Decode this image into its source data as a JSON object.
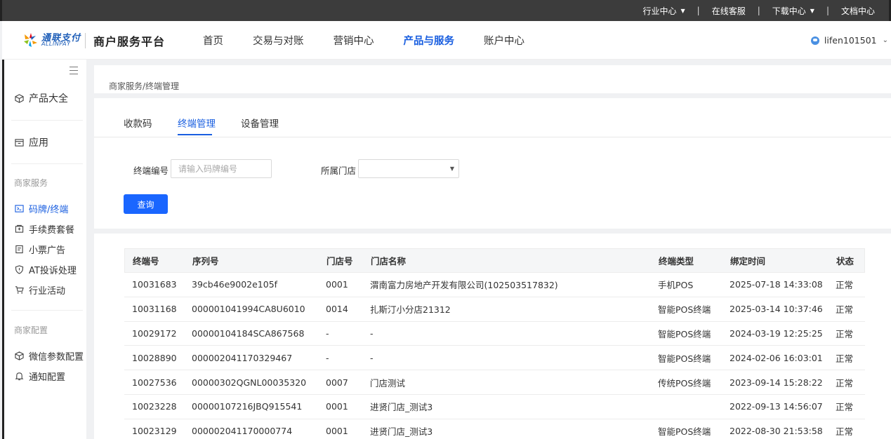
{
  "topbar": {
    "links": [
      {
        "label": "行业中心",
        "has_caret": true
      },
      {
        "label": "在线客服",
        "has_caret": false
      },
      {
        "label": "下载中心",
        "has_caret": true
      },
      {
        "label": "文档中心",
        "has_caret": false
      }
    ],
    "separator": "|"
  },
  "header": {
    "logo_name": "通联支付",
    "logo_sub": "ALLINPAY",
    "platform": "商户服务平台",
    "nav": [
      {
        "label": "首页",
        "active": false
      },
      {
        "label": "交易与对账",
        "active": false
      },
      {
        "label": "营销中心",
        "active": false
      },
      {
        "label": "产品与服务",
        "active": true
      },
      {
        "label": "账户中心",
        "active": false
      }
    ],
    "username": "lifen101501"
  },
  "sidebar": {
    "top_items": [
      {
        "label": "产品大全",
        "icon": "cube-icon"
      },
      {
        "label": "应用",
        "icon": "app-box-icon"
      }
    ],
    "group1_title": "商家服务",
    "group1_items": [
      {
        "label": "码牌/终端",
        "icon": "terminal-icon",
        "active": true
      },
      {
        "label": "手续费套餐",
        "icon": "fee-package-icon",
        "active": false
      },
      {
        "label": "小票广告",
        "icon": "receipt-icon",
        "active": false
      },
      {
        "label": "AT投诉处理",
        "icon": "shield-icon",
        "active": false
      },
      {
        "label": "行业活动",
        "icon": "cart-icon",
        "active": false
      }
    ],
    "group2_title": "商家配置",
    "group2_items": [
      {
        "label": "微信参数配置",
        "icon": "cube-icon"
      },
      {
        "label": "通知配置",
        "icon": "bell-icon"
      }
    ]
  },
  "breadcrumb": "商家服务/终端管理",
  "tabs": [
    {
      "label": "收款码",
      "active": false
    },
    {
      "label": "终端管理",
      "active": true
    },
    {
      "label": "设备管理",
      "active": false
    }
  ],
  "filter": {
    "terminal_label": "终端编号",
    "terminal_placeholder": "请输入码牌编号",
    "terminal_value": "",
    "store_label": "所属门店",
    "store_value": "",
    "query_button": "查询"
  },
  "table": {
    "columns": [
      "终端号",
      "序列号",
      "门店号",
      "门店名称",
      "终端类型",
      "绑定时间",
      "状态"
    ],
    "rows": [
      [
        "10031683",
        "39cb46e9002e105f",
        "0001",
        "渭南富力房地产开发有限公司(102503517832)",
        "手机POS",
        "2025-07-18 14:33:08",
        "正常"
      ],
      [
        "10031168",
        "000001041994CA8U6010",
        "0014",
        "扎斯汀小分店21312",
        "智能POS终端",
        "2025-03-14 10:37:46",
        "正常"
      ],
      [
        "10029172",
        "00000104184SCA867568",
        "-",
        "-",
        "智能POS终端",
        "2024-03-19 12:25:25",
        "正常"
      ],
      [
        "10028890",
        "000002041170329467",
        "-",
        "-",
        "智能POS终端",
        "2024-02-06 16:03:01",
        "正常"
      ],
      [
        "10027536",
        "00000302QGNL00035320",
        "0007",
        "门店测试",
        "传统POS终端",
        "2023-09-14 15:28:22",
        "正常"
      ],
      [
        "10023228",
        "00000107216JBQ915541",
        "0001",
        "进贤门店_测试3",
        "",
        "2022-09-13 14:56:07",
        "正常"
      ],
      [
        "10023129",
        "000002041170000774",
        "0001",
        "进贤门店_测试3",
        "智能POS终端",
        "2022-08-30 21:53:58",
        "正常"
      ]
    ]
  },
  "colors": {
    "accent": "#1a5fe0",
    "button": "#1a66ff",
    "topbar": "#3c3c3c"
  }
}
